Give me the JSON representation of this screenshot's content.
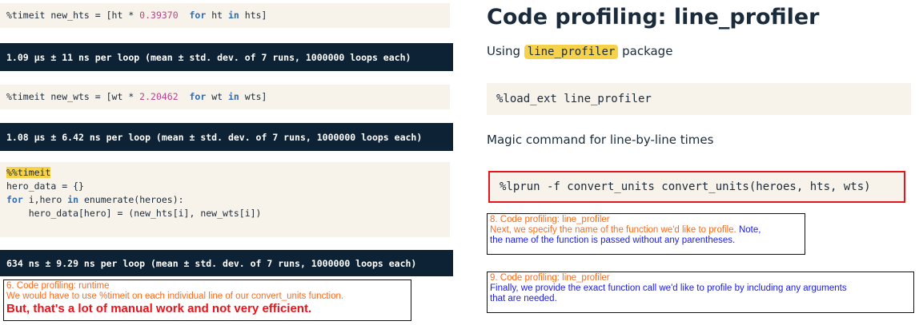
{
  "left": {
    "cell1": {
      "prefix": "%timeit new_hts = [ht * ",
      "number": "0.39370",
      "kw_for": "for",
      "mid": " ht ",
      "kw_in": "in",
      "suffix": " hts]"
    },
    "out1": "1.09 µs ± 11 ns per loop (mean ± std. dev. of 7 runs, 1000000 loops each)",
    "cell2": {
      "prefix": "%timeit new_wts = [wt * ",
      "number": "2.20462",
      "kw_for": "for",
      "mid": " wt ",
      "kw_in": "in",
      "suffix": " wts]"
    },
    "out2": "1.08 µs ± 6.42 ns per loop (mean ± std. dev. of 7 runs, 1000000 loops each)",
    "cell3": {
      "magic": "%%timeit",
      "line2": "hero_data = {}",
      "line3_kw_for": "for",
      "line3_mid": " i,hero ",
      "line3_kw_in": "in",
      "line3_rest": " enumerate(heroes):",
      "line4": "    hero_data[hero] = (new_hts[i], new_wts[i])"
    },
    "out3": "634 ns ± 9.29 ns per loop (mean ± std. dev. of 7 runs, 1000000 loops each)",
    "note": {
      "heading": "6. Code profiling: runtime",
      "line1": "We would have to use %timeit on each individual line of our convert_units function.",
      "line2": "But, that's a lot of manual work and not very efficient."
    }
  },
  "right": {
    "title": "Code profiling: line_profiler",
    "subtitle_prefix": "Using ",
    "subtitle_pkg": "line_profiler",
    "subtitle_suffix": " package",
    "code1": "%load_ext line_profiler",
    "text1": "Magic command for line-by-line times",
    "code2": "%lprun -f convert_units convert_units(heroes, hts, wts)",
    "note8": {
      "heading": "8. Code profiling: line_profiler",
      "orange": "Next, we specify the name of the function we'd like to profile. ",
      "blue_inline": "Note,",
      "blue_line": "the name of the function is passed without any parentheses."
    },
    "note9": {
      "heading": "9. Code profiling: line_profiler",
      "line1": "Finally, we provide the exact function call we'd like to profile by including any arguments",
      "line2": "that are needed."
    }
  }
}
